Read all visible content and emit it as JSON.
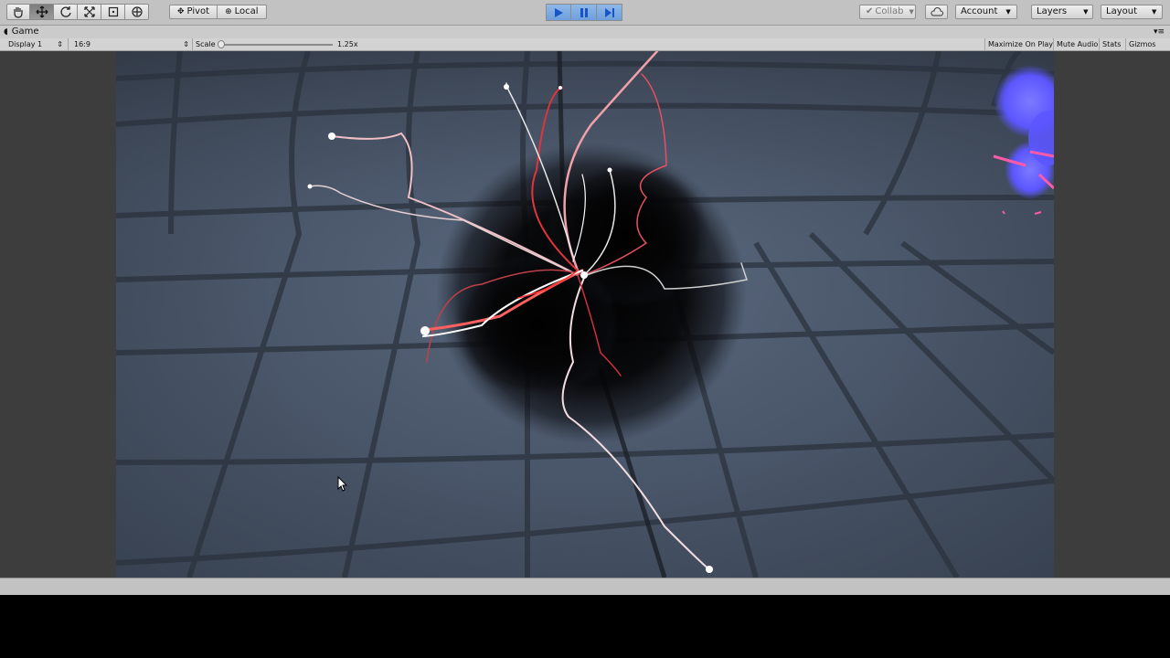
{
  "toolbar": {
    "tools": [
      {
        "icon": "hand-icon"
      },
      {
        "icon": "move-icon",
        "active": true
      },
      {
        "icon": "rotate-icon"
      },
      {
        "icon": "scale-icon"
      },
      {
        "icon": "rect-icon"
      },
      {
        "icon": "transform-icon"
      }
    ],
    "pivot_label": "Pivot",
    "local_label": "Local",
    "collab_label": "Collab",
    "account_label": "Account",
    "layers_label": "Layers",
    "layout_label": "Layout"
  },
  "panel": {
    "tab_title": "Game",
    "display_label": "Display 1",
    "aspect_label": "16:9",
    "scale_label": "Scale",
    "scale_value": "1.25x",
    "maximize_label": "Maximize On Play",
    "mute_label": "Mute Audio",
    "stats_label": "Stats",
    "gizmos_label": "Gizmos"
  },
  "colors": {
    "play_active": "#6e9fdb",
    "tendril_red": "#e0353a",
    "orb_blue": "#5b56ff"
  }
}
